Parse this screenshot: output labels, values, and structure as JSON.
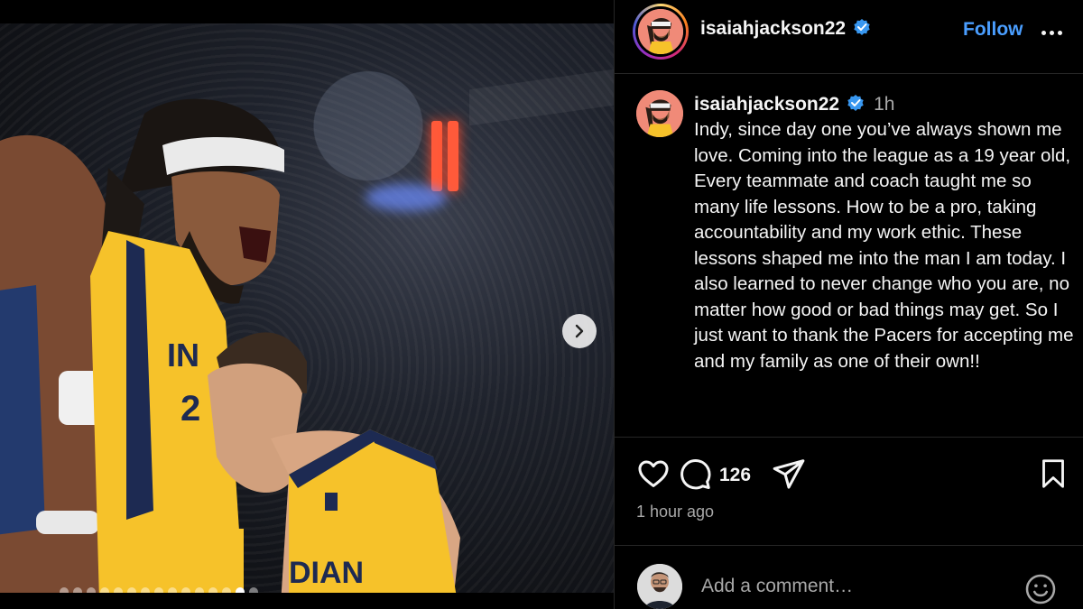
{
  "post": {
    "username": "isaiahjackson22",
    "verified": true,
    "follow_label": "Follow",
    "time_short": "1h",
    "time_long": "1 hour ago",
    "caption": "Indy, since day one you’ve always shown me love. Coming into the league as a 19 year old, Every teammate and coach taught me so many life lessons. How to be a pro, taking accountability and my work ethic. These lessons shaped me into the man I am today. I also learned to never change who you are, no matter how good or bad things may get. So I just want to thank the Pacers for accepting me and my family as one of their own!!",
    "comment_count": "126",
    "comment_placeholder": "Add a comment…"
  },
  "carousel": {
    "total_slides": 15,
    "active_slide": 14
  },
  "colors": {
    "accent_link": "#4a9eff",
    "verified_badge": "#3897f0",
    "background": "#000000",
    "muted_text": "#a8a8a8"
  },
  "icons": {
    "verified": "verified-badge-icon",
    "more": "more-options-icon",
    "next": "chevron-right-icon",
    "like": "heart-icon",
    "comment": "comment-bubble-icon",
    "share": "paper-plane-icon",
    "save": "bookmark-icon",
    "emoji": "smiley-icon"
  }
}
